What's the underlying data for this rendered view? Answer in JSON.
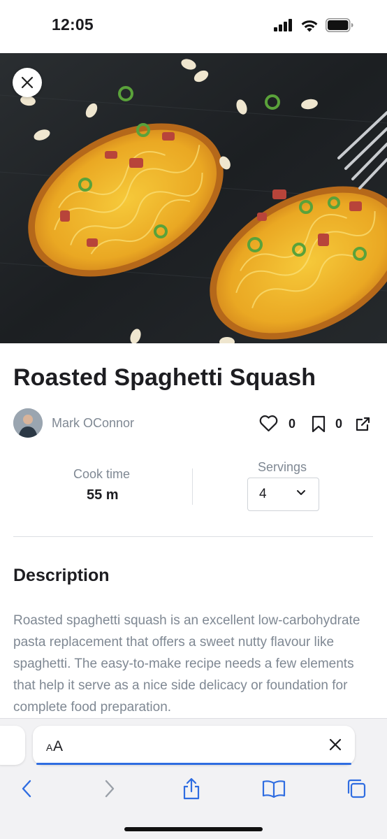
{
  "status_bar": {
    "time": "12:05"
  },
  "recipe": {
    "title": "Roasted Spaghetti Squash",
    "author": "Mark OConnor",
    "likes": "0",
    "saves": "0",
    "cook_time_label": "Cook time",
    "cook_time_value": "55 m",
    "servings_label": "Servings",
    "servings_value": "4",
    "description_heading": "Description",
    "description_text": "Roasted spaghetti squash is an excellent low-carbohydrate pasta replacement that offers a sweet nutty flavour like spaghetti. The easy-to-make recipe needs a few elements that help it serve as a nice side delicacy or foundation for complete food preparation."
  },
  "browser": {
    "address_text": "AA"
  },
  "icons": {
    "close": "close-icon",
    "like": "heart-icon",
    "save": "bookmark-icon",
    "share": "share-icon",
    "servings_dropdown": "chevron-down-icon",
    "back": "chevron-left-icon",
    "forward": "chevron-right-icon",
    "browser_share": "share-icon",
    "bookmarks": "book-icon",
    "tabs": "tabs-icon"
  },
  "colors": {
    "text_primary": "#1d1d21",
    "text_secondary": "#7f8893",
    "accent": "#2f6de1",
    "squash": "#e8a21c"
  }
}
